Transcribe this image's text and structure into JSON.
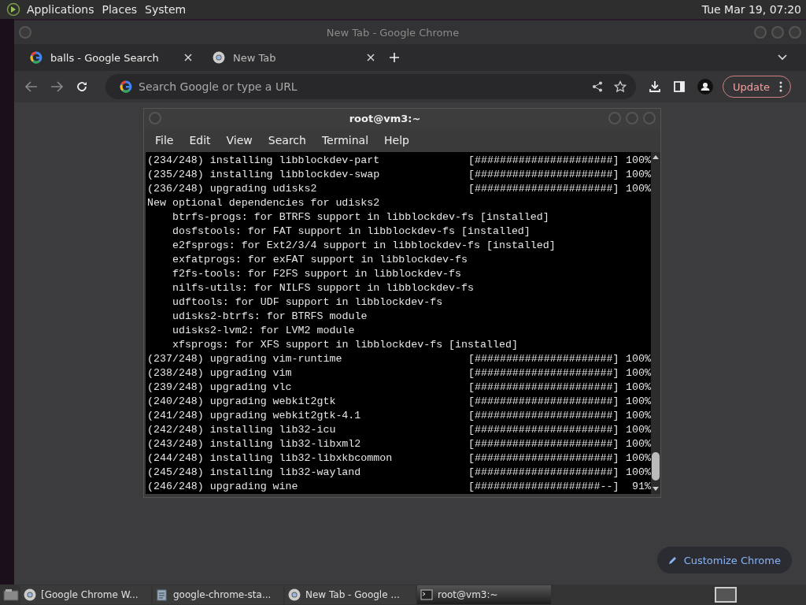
{
  "top_panel": {
    "menus": [
      "Applications",
      "Places",
      "System"
    ],
    "clock": "Tue Mar 19, 07:20"
  },
  "chrome": {
    "title": "New Tab - Google Chrome",
    "tabs": [
      {
        "label": "balls - Google Search",
        "selected": false
      },
      {
        "label": "New Tab",
        "selected": true
      }
    ],
    "address": {
      "placeholder": "Search Google or type a URL"
    },
    "update_button": "Update",
    "customize_button": "Customize Chrome"
  },
  "terminal": {
    "title": "root@vm3:~",
    "menus": [
      "File",
      "Edit",
      "View",
      "Search",
      "Terminal",
      "Help"
    ],
    "lines": [
      {
        "kind": "progress",
        "text": "(234/248) installing libblockdev-part",
        "bar": "[######################]",
        "percent": "100%"
      },
      {
        "kind": "progress",
        "text": "(235/248) installing libblockdev-swap",
        "bar": "[######################]",
        "percent": "100%"
      },
      {
        "kind": "progress",
        "text": "(236/248) upgrading udisks2",
        "bar": "[######################]",
        "percent": "100%"
      },
      {
        "kind": "note",
        "text": "New optional dependencies for udisks2",
        "children": [
          "btrfs-progs: for BTRFS support in libblockdev-fs [installed]",
          "dosfstools: for FAT support in libblockdev-fs [installed]",
          "e2fsprogs: for Ext2/3/4 support in libblockdev-fs [installed]",
          "exfatprogs: for exFAT support in libblockdev-fs",
          "f2fs-tools: for F2FS support in libblockdev-fs",
          "nilfs-utils: for NILFS support in libblockdev-fs",
          "udftools: for UDF support in libblockdev-fs",
          "udisks2-btrfs: for BTRFS module",
          "udisks2-lvm2: for LVM2 module",
          "xfsprogs: for XFS support in libblockdev-fs [installed]"
        ]
      },
      {
        "kind": "progress",
        "text": "(237/248) upgrading vim-runtime",
        "bar": "[######################]",
        "percent": "100%"
      },
      {
        "kind": "progress",
        "text": "(238/248) upgrading vim",
        "bar": "[######################]",
        "percent": "100%"
      },
      {
        "kind": "progress",
        "text": "(239/248) upgrading vlc",
        "bar": "[######################]",
        "percent": "100%"
      },
      {
        "kind": "progress",
        "text": "(240/248) upgrading webkit2gtk",
        "bar": "[######################]",
        "percent": "100%"
      },
      {
        "kind": "progress",
        "text": "(241/248) upgrading webkit2gtk-4.1",
        "bar": "[######################]",
        "percent": "100%"
      },
      {
        "kind": "progress",
        "text": "(242/248) installing lib32-icu",
        "bar": "[######################]",
        "percent": "100%"
      },
      {
        "kind": "progress",
        "text": "(243/248) installing lib32-libxml2",
        "bar": "[######################]",
        "percent": "100%"
      },
      {
        "kind": "progress",
        "text": "(244/248) installing lib32-libxkbcommon",
        "bar": "[######################]",
        "percent": "100%"
      },
      {
        "kind": "progress",
        "text": "(245/248) installing lib32-wayland",
        "bar": "[######################]",
        "percent": "100%"
      },
      {
        "kind": "progress",
        "text": "(246/248) upgrading wine",
        "bar": "[####################--]",
        "percent": "91%"
      }
    ]
  },
  "taskbar": [
    {
      "label": "[Google Chrome W...",
      "kind": "browser",
      "selected": false
    },
    {
      "label": "google-chrome-sta...",
      "kind": "file",
      "selected": false
    },
    {
      "label": "New Tab - Google ...",
      "kind": "browser",
      "selected": false
    },
    {
      "label": "root@vm3:~",
      "kind": "terminal",
      "selected": true
    }
  ]
}
